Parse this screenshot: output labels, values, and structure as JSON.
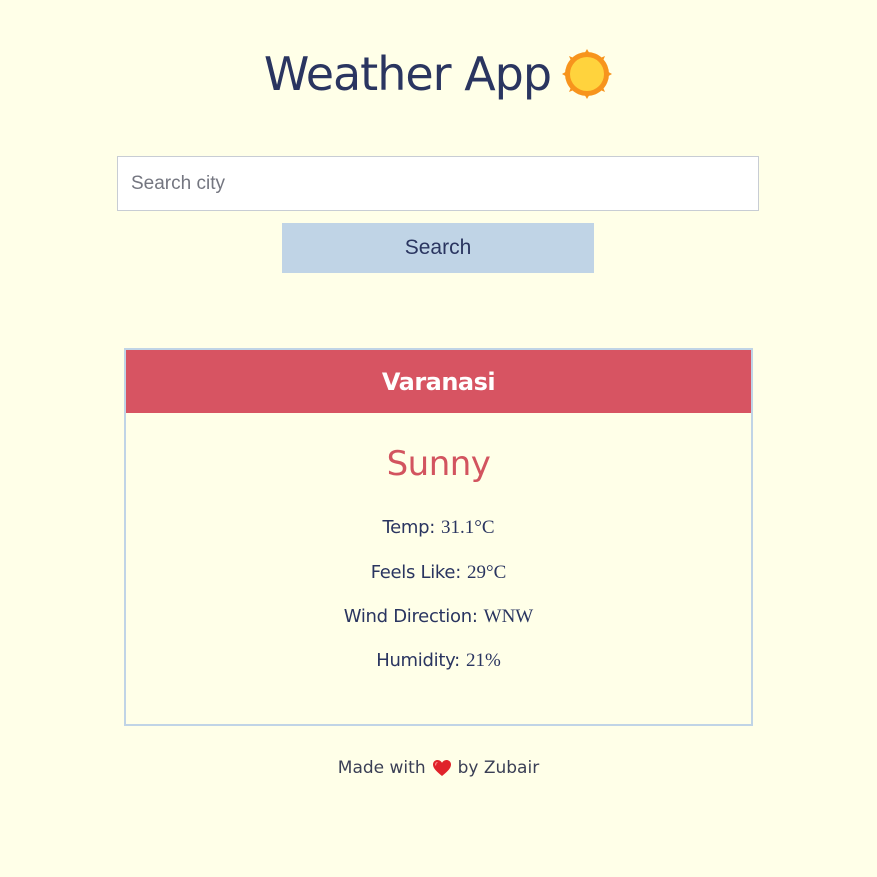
{
  "header": {
    "title": "Weather App",
    "title_icon": "sun-icon"
  },
  "search": {
    "placeholder": "Search city",
    "value": "",
    "button_label": "Search"
  },
  "weather_card": {
    "city": "Varanasi",
    "condition": "Sunny",
    "stats": [
      {
        "label": "Temp:",
        "value": "31.1°C"
      },
      {
        "label": "Feels Like:",
        "value": "29°C"
      },
      {
        "label": "Wind Direction:",
        "value": "WNW"
      },
      {
        "label": "Humidity:",
        "value": "21%"
      }
    ]
  },
  "footer": {
    "prefix": "Made with",
    "icon": "heart-icon",
    "suffix": "by Zubair"
  },
  "colors": {
    "background": "#ffffe8",
    "text": "#2a3560",
    "accent": "#d75462",
    "button": "#c0d4e6",
    "sun": "#ffd33d",
    "sun_rays": "#f7941d",
    "heart": "#e0232a"
  }
}
